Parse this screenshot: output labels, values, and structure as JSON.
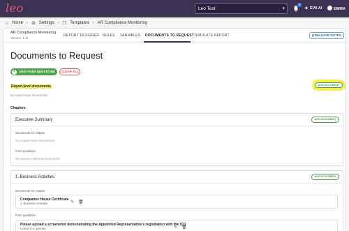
{
  "app": {
    "logo": "leo"
  },
  "topbar": {
    "tenant": "Leo Test",
    "notifications_count": "5",
    "eva_label": "EVA AI",
    "user_label": "EMMA"
  },
  "breadcrumb": {
    "home": "Home",
    "settings": "Settings",
    "templates": "Templates",
    "current": "AR Compliance Monitoring"
  },
  "project": {
    "name": "AR Compliance Monitoring",
    "version": "Version: 1.11"
  },
  "tabs": [
    {
      "label": "REPORT DESIGNER"
    },
    {
      "label": "RULES"
    },
    {
      "label": "VARIABLES"
    },
    {
      "label": "DOCUMENTS TO REQUEST"
    },
    {
      "label": "SIMULATE REPORT"
    }
  ],
  "release_notes": "RELEASE NOTES",
  "page": {
    "title": "Documents to Request",
    "add_from_questions": "ADD FROM QUESTIONS",
    "clear_all": "CLEAR ALL",
    "report_level_title": "Report-level documents",
    "no_report_docs": "No report-level documents.",
    "add_document": "ADD DOCUMENT",
    "chapters_title": "Chapters"
  },
  "chapters": [
    {
      "title": "Executive Summary",
      "add_document": "ADD DOCUMENT",
      "docs_for_chapter_label": "Documents for chapter",
      "no_chapter_docs": "No chapter-level documents.",
      "from_questions_label": "From questions",
      "no_question_docs": "No question-derived documents."
    },
    {
      "title": "1. Business Activities",
      "add_document": "ADD DOCUMENT",
      "docs_for_chapter_label": "Documents for chapter",
      "chapter_doc": {
        "title": "Companies House Certificate",
        "sub": "1. Business Activities"
      },
      "from_questions_label": "From questions",
      "question_doc": {
        "title": "Please upload a screenshot demonstrating the Appointed Representative's registration with the ICO",
        "sub": "Linked to a question"
      }
    }
  ],
  "colors": {
    "topbar": "#3c3253",
    "accent_green": "#4ea24a",
    "clear_red": "#d44a4a",
    "highlight_yellow": "#f5f06a"
  }
}
